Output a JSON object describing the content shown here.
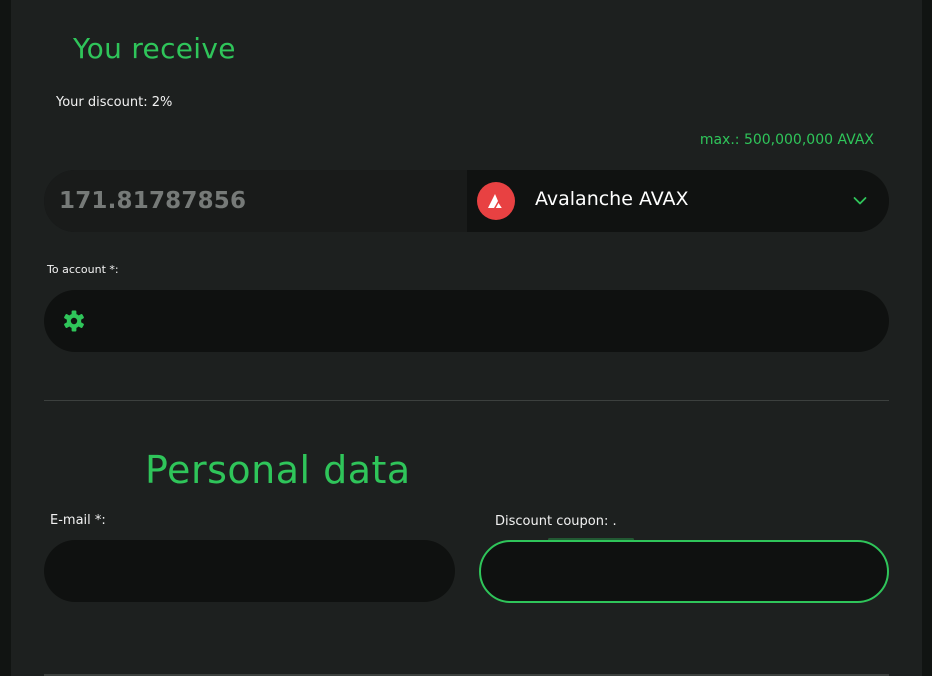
{
  "receive": {
    "heading": "You receive",
    "discount_text": "Your discount: 2%",
    "max_text": "max.: 500,000,000 AVAX",
    "amount_value": "171.81787856",
    "currency": {
      "label": "Avalanche AVAX",
      "icon": "avalanche-logo-icon",
      "brand_color": "#e84142"
    }
  },
  "account": {
    "label": "To account *:",
    "value": "",
    "icon": "gear-icon"
  },
  "personal": {
    "heading": "Personal data",
    "email_label": "E-mail *:",
    "email_value": "",
    "coupon_label": "Discount coupon: .",
    "coupon_value": ""
  },
  "colors": {
    "accent": "#2fc55a",
    "panel": "#1d201f",
    "field": "#0f1110"
  }
}
